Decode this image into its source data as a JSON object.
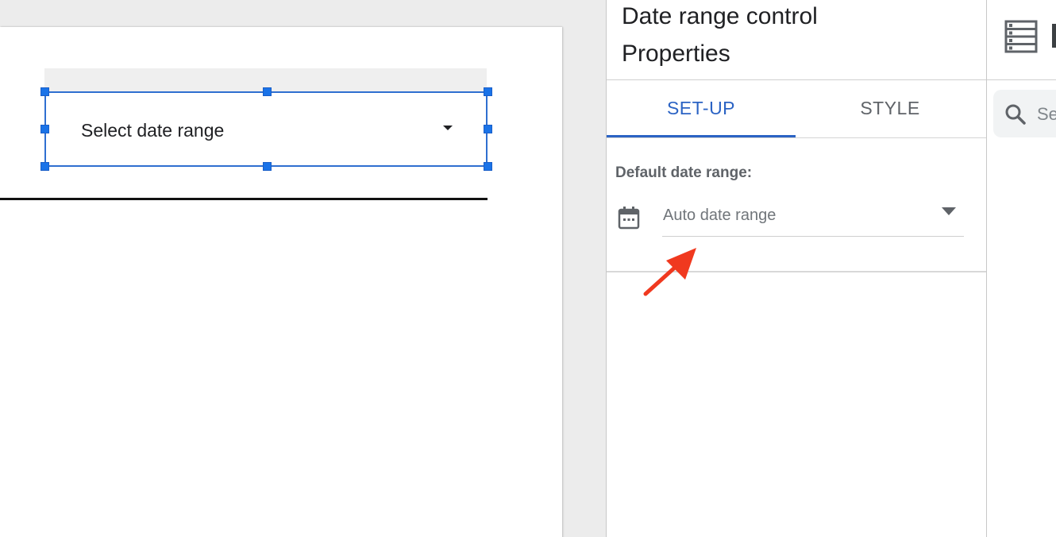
{
  "canvas": {
    "date_control": {
      "label": "Select date range",
      "caret_icon": "caret-down-icon"
    }
  },
  "properties_panel": {
    "title_line1": "Date range control",
    "title_line2": "Properties",
    "tabs": [
      {
        "label": "SET-UP",
        "active": true
      },
      {
        "label": "STYLE",
        "active": false
      }
    ],
    "default_date_range": {
      "label": "Default date range:",
      "icon": "calendar-icon",
      "value": "Auto date range",
      "caret_icon": "caret-down-icon"
    }
  },
  "data_panel": {
    "header_icon": "data-source-icon",
    "search": {
      "icon": "search-icon",
      "placeholder": "Se"
    }
  },
  "colors": {
    "accent": "#2b63c4",
    "selection": "#1a73e8",
    "annotation_arrow": "#f0391f",
    "canvas_background": "#ececec"
  }
}
